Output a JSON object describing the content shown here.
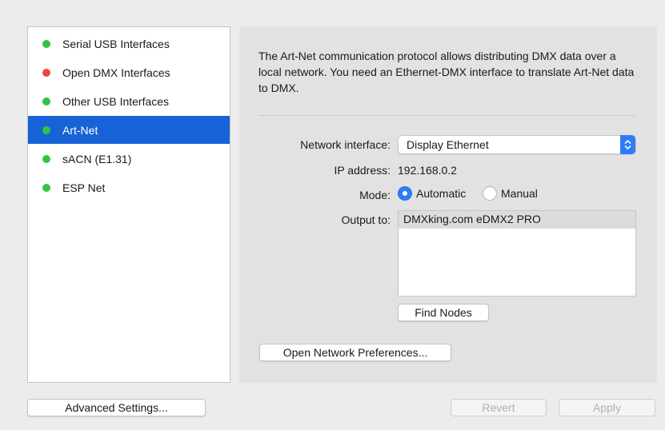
{
  "sidebar": {
    "items": [
      {
        "label": "Serial USB Interfaces",
        "status_color": "#2fc542",
        "selected": false
      },
      {
        "label": "Open DMX Interfaces",
        "status_color": "#f0473c",
        "selected": false
      },
      {
        "label": "Other USB Interfaces",
        "status_color": "#2fc542",
        "selected": false
      },
      {
        "label": "Art-Net",
        "status_color": "#2fc542",
        "selected": true
      },
      {
        "label": "sACN (E1.31)",
        "status_color": "#2fc542",
        "selected": false
      },
      {
        "label": "ESP Net",
        "status_color": "#2fc542",
        "selected": false
      }
    ]
  },
  "panel": {
    "description": "The Art-Net communication protocol allows distributing DMX data over a local network. You need an Ethernet-DMX interface to translate Art-Net data to DMX.",
    "network_interface": {
      "label": "Network interface:",
      "value": "Display Ethernet",
      "icon": "chevron-up-down-icon"
    },
    "ip_address": {
      "label": "IP address:",
      "value": "192.168.0.2"
    },
    "mode": {
      "label": "Mode:",
      "options": [
        {
          "label": "Automatic",
          "selected": true
        },
        {
          "label": "Manual",
          "selected": false
        }
      ]
    },
    "output_to": {
      "label": "Output to:",
      "items": [
        "DMXking.com eDMX2 PRO"
      ]
    },
    "find_nodes_label": "Find Nodes",
    "open_network_prefs_label": "Open Network Preferences..."
  },
  "footer": {
    "advanced_settings_label": "Advanced Settings...",
    "revert_label": "Revert",
    "apply_label": "Apply"
  },
  "colors": {
    "accent": "#2f7cf6",
    "selection": "#1762d6",
    "status_green": "#2fc542",
    "status_red": "#f0473c"
  }
}
